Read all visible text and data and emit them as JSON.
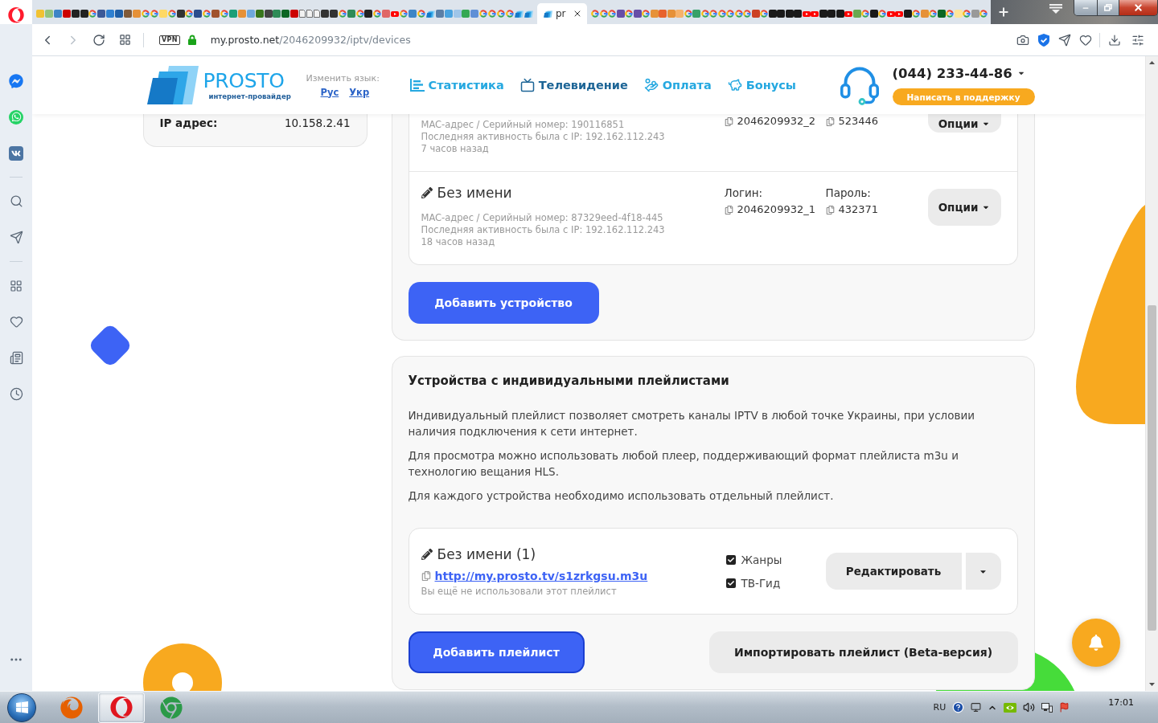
{
  "browser": {
    "tabs": [
      {
        "kind": "tile",
        "color": "#f1c232",
        "selected": false
      },
      {
        "kind": "tile",
        "color": "#93c47d",
        "selected": false
      },
      {
        "kind": "tile",
        "color": "#3d85c6",
        "selected": false
      },
      {
        "kind": "tile",
        "color": "#cc0000",
        "selected": false
      },
      {
        "kind": "tile",
        "color": "#222222",
        "selected": false
      },
      {
        "kind": "tile",
        "color": "#222222",
        "selected": false
      },
      {
        "kind": "g",
        "selected": false
      },
      {
        "kind": "tile",
        "color": "#3b5998",
        "selected": false
      },
      {
        "kind": "tile",
        "color": "#2f80d1",
        "selected": false
      },
      {
        "kind": "tile",
        "color": "#1f5fa8",
        "selected": false
      },
      {
        "kind": "tile",
        "color": "#7f5a3a",
        "selected": false
      },
      {
        "kind": "tile",
        "color": "#e69138",
        "selected": false
      },
      {
        "kind": "g",
        "selected": false
      },
      {
        "kind": "g",
        "selected": false
      },
      {
        "kind": "tile",
        "color": "#ffd966",
        "selected": false
      },
      {
        "kind": "g",
        "selected": false
      },
      {
        "kind": "tile",
        "color": "#333333",
        "selected": false
      },
      {
        "kind": "g",
        "selected": false
      },
      {
        "kind": "tile",
        "color": "#2b4c8c",
        "selected": false
      },
      {
        "kind": "g",
        "selected": false
      },
      {
        "kind": "tile",
        "color": "#a0522d",
        "selected": false
      },
      {
        "kind": "g",
        "selected": false
      },
      {
        "kind": "tile",
        "color": "#1b9e77",
        "selected": false
      },
      {
        "kind": "tile",
        "color": "#e69138",
        "selected": false
      },
      {
        "kind": "tile",
        "color": "#6fa8dc",
        "selected": false
      },
      {
        "kind": "tile",
        "color": "#38761d",
        "selected": false
      },
      {
        "kind": "tile",
        "color": "#444444",
        "selected": false
      },
      {
        "kind": "tile",
        "color": "#2e8b57",
        "selected": false
      },
      {
        "kind": "tile",
        "color": "#0b6623",
        "selected": false
      },
      {
        "kind": "tile",
        "color": "#cc0000",
        "selected": false
      },
      {
        "kind": "doc",
        "selected": false
      },
      {
        "kind": "doc",
        "selected": false
      },
      {
        "kind": "doc",
        "selected": false
      },
      {
        "kind": "tile",
        "color": "#333333",
        "selected": false
      },
      {
        "kind": "tile",
        "color": "#333333",
        "selected": false
      },
      {
        "kind": "g",
        "selected": false
      },
      {
        "kind": "tile",
        "color": "#2e8b57",
        "selected": false
      },
      {
        "kind": "g",
        "selected": false
      },
      {
        "kind": "tile",
        "color": "#222222",
        "selected": false
      },
      {
        "kind": "g",
        "selected": false
      },
      {
        "kind": "tile",
        "color": "#e06666",
        "selected": false
      },
      {
        "kind": "play",
        "selected": false
      },
      {
        "kind": "g",
        "selected": false
      },
      {
        "kind": "tile",
        "color": "#3d85c6",
        "selected": false
      },
      {
        "kind": "g",
        "selected": false
      },
      {
        "kind": "logo",
        "selected": false
      },
      {
        "kind": "tile",
        "color": "#5b7fa6",
        "selected": false
      },
      {
        "kind": "tile",
        "color": "#4aa3df",
        "selected": false
      },
      {
        "kind": "tile",
        "color": "#9fc5e8",
        "selected": false
      },
      {
        "kind": "tile",
        "color": "#34a853",
        "selected": false
      },
      {
        "kind": "tile",
        "color": "#5f8fd6",
        "selected": false
      },
      {
        "kind": "g",
        "selected": false
      },
      {
        "kind": "g",
        "selected": false
      },
      {
        "kind": "g",
        "selected": false
      },
      {
        "kind": "g",
        "selected": false
      },
      {
        "kind": "logo",
        "selected": false
      },
      {
        "kind": "logo",
        "selected": false
      },
      {
        "kind": "logo",
        "title": "pr",
        "selected": true
      },
      {
        "kind": "g",
        "selected": false
      },
      {
        "kind": "g",
        "selected": false
      },
      {
        "kind": "g",
        "selected": false
      },
      {
        "kind": "tile",
        "color": "#674ea7",
        "selected": false
      },
      {
        "kind": "g",
        "selected": false
      },
      {
        "kind": "tile",
        "color": "#674ea7",
        "selected": false
      },
      {
        "kind": "g",
        "selected": false
      },
      {
        "kind": "tile",
        "color": "#e69138",
        "selected": false
      },
      {
        "kind": "tile",
        "color": "#e8622c",
        "selected": false
      },
      {
        "kind": "tile",
        "color": "#e69138",
        "selected": false
      },
      {
        "kind": "tile",
        "color": "#f6b26b",
        "selected": false
      },
      {
        "kind": "g",
        "selected": false
      },
      {
        "kind": "tile",
        "color": "#38a169",
        "selected": false
      },
      {
        "kind": "g",
        "selected": false
      },
      {
        "kind": "g",
        "selected": false
      },
      {
        "kind": "g",
        "selected": false
      },
      {
        "kind": "g",
        "selected": false
      },
      {
        "kind": "g",
        "selected": false
      },
      {
        "kind": "g",
        "selected": false
      },
      {
        "kind": "tile",
        "color": "#cc4125",
        "selected": false
      },
      {
        "kind": "g",
        "selected": false
      },
      {
        "kind": "tile",
        "color": "#1a1a1a",
        "selected": false
      },
      {
        "kind": "tile",
        "color": "#1a1a1a",
        "selected": false
      },
      {
        "kind": "tile",
        "color": "#1a1a1a",
        "selected": false
      },
      {
        "kind": "tile",
        "color": "#1a1a1a",
        "selected": false
      },
      {
        "kind": "play",
        "selected": false
      },
      {
        "kind": "play",
        "selected": false
      },
      {
        "kind": "tile",
        "color": "#1a1a1a",
        "selected": false
      },
      {
        "kind": "tile",
        "color": "#1a1a1a",
        "selected": false
      },
      {
        "kind": "tile",
        "color": "#1a1a1a",
        "selected": false
      },
      {
        "kind": "play",
        "selected": false
      },
      {
        "kind": "tile",
        "color": "#6aa84f",
        "selected": false
      },
      {
        "kind": "g",
        "selected": false
      },
      {
        "kind": "tile",
        "color": "#1a1a1a",
        "selected": false
      },
      {
        "kind": "g",
        "selected": false
      },
      {
        "kind": "play",
        "selected": false
      },
      {
        "kind": "play",
        "selected": false
      },
      {
        "kind": "tile",
        "color": "#1a1a1a",
        "selected": false
      },
      {
        "kind": "g",
        "selected": false
      },
      {
        "kind": "tile",
        "color": "#e69138",
        "selected": false
      },
      {
        "kind": "g",
        "selected": false
      },
      {
        "kind": "tile",
        "color": "#0b6623",
        "selected": false
      },
      {
        "kind": "g",
        "selected": false
      },
      {
        "kind": "tile",
        "color": "#ffe599",
        "selected": false
      },
      {
        "kind": "g",
        "selected": false
      },
      {
        "kind": "tile",
        "color": "#999999",
        "selected": false
      },
      {
        "kind": "g",
        "selected": false
      }
    ],
    "vpn": "VPN",
    "url": {
      "host": "my.prosto.net",
      "path": "/2046209932/iptv/devices"
    }
  },
  "header": {
    "logo": {
      "wordmark": "PROSTO",
      "tagline": "интернет-провайдер"
    },
    "language": {
      "label": "Изменить язык:",
      "options": [
        {
          "label": "Рус"
        },
        {
          "label": "Укр"
        }
      ]
    },
    "nav": [
      {
        "label": "Статистика",
        "kind": "chart",
        "selected": false
      },
      {
        "label": "Телевидение",
        "kind": "tv",
        "selected": true
      },
      {
        "label": "Оплата",
        "kind": "coins",
        "selected": false
      },
      {
        "label": "Бонусы",
        "kind": "piggy",
        "selected": false
      }
    ],
    "phone": "(044) 233-44-86",
    "support_button": "Написать в поддержку"
  },
  "account": {
    "rows": [
      {
        "label": "IP адрес:",
        "value": "10.158.2.41"
      }
    ]
  },
  "devices": {
    "items": [
      {
        "mac": "MAC-адрес / Серийный номер: 190116851",
        "activity": "Последняя активность была с IP: 192.162.112.243",
        "last_seen": "7 часов назад",
        "login": "2046209932_2",
        "password": "523446",
        "options_button": "Опции"
      },
      {
        "name": "Без имени",
        "mac": "MAC-адрес / Серийный номер: 87329eed-4f18-445",
        "activity": "Последняя активность была с IP: 192.162.112.243",
        "last_seen": "18 часов назад",
        "login_label": "Логин:",
        "login": "2046209932_1",
        "password_label": "Пароль:",
        "password": "432371",
        "options_button": "Опции"
      }
    ],
    "add_button": "Добавить устройство"
  },
  "playlists": {
    "title": "Устройства с индивидуальными плейлистами",
    "paragraphs": [
      "Индивидуальный плейлист позволяет смотреть каналы IPTV в любой точке Украины, при условии наличия подключения к сети интернет.",
      "Для просмотра можно использовать любой плеер, поддерживающий формат плейлиста m3u и технологию вещания HLS.",
      "Для каждого устройства необходимо использовать отдельный плейлист."
    ],
    "items": [
      {
        "name": "Без имени (1)",
        "url": "http://my.prosto.tv/s1zrkgsu.m3u",
        "note": "Вы ещё не использовали этот плейлист",
        "options": [
          {
            "label": "Жанры",
            "checked": true
          },
          {
            "label": "ТВ-Гид",
            "checked": true
          }
        ],
        "edit_button": "Редактировать"
      }
    ],
    "add_button": {
      "label": "Добавить плейлист",
      "focused": true
    },
    "import_button": "Импортировать плейлист (Beta-версия)"
  },
  "taskbar": {
    "apps": [
      {
        "kind": "fox",
        "selected": false
      },
      {
        "kind": "ring",
        "selected": true
      },
      {
        "kind": "wheel",
        "selected": false
      }
    ],
    "language": "RU",
    "clock": "17:01"
  }
}
